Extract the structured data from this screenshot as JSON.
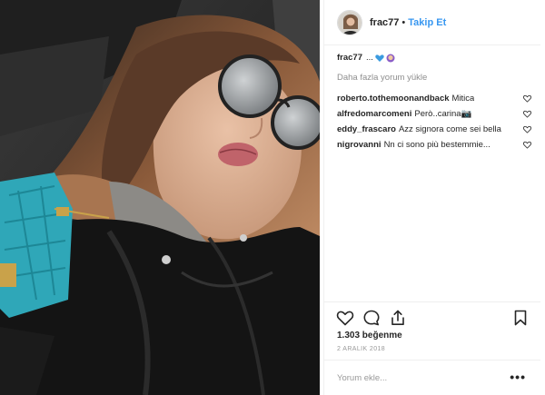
{
  "post": {
    "username": "frac77",
    "follow_label": "Takip Et",
    "dot": "•",
    "caption": {
      "username": "frac77",
      "text": "...",
      "emojis": [
        "blue-heart",
        "person-emoji"
      ]
    },
    "more_comments_label": "Daha fazla yorum yükle",
    "comments": [
      {
        "username": "roberto.tothemoonandback",
        "text": "Mitica"
      },
      {
        "username": "alfredomarcomeni",
        "text": "Però..carina📷"
      },
      {
        "username": "eddy_frascaro",
        "text": "Azz signora come sei bella"
      },
      {
        "username": "nigrovanni",
        "text": "Nn ci sono più bestemmie..."
      }
    ],
    "likes": "1.303 beğenme",
    "date": "2 ARALIK 2018",
    "add_comment_placeholder": "Yorum ekle...",
    "more_options": "•••"
  },
  "icons": [
    "heart-icon",
    "comment-icon",
    "share-icon",
    "bookmark-icon"
  ],
  "colors": {
    "follow": "#3897f0",
    "border": "#efefef",
    "muted": "#8e8e8e"
  }
}
